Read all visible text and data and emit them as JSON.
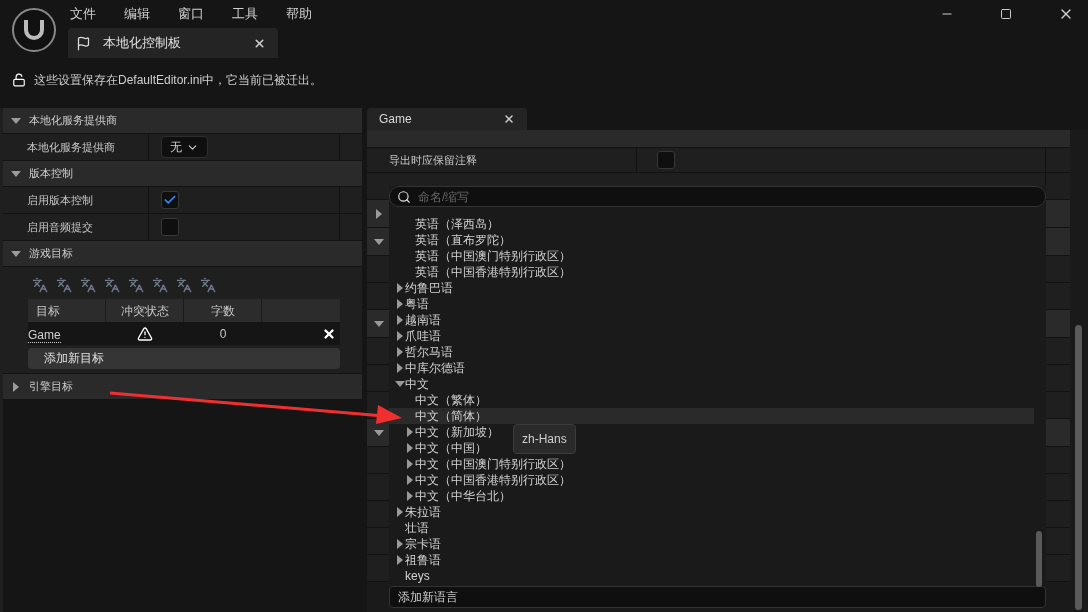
{
  "window": {
    "menu": [
      "文件",
      "编辑",
      "窗口",
      "工具",
      "帮助"
    ],
    "tab": {
      "label": "本地化控制板"
    }
  },
  "notice": "这些设置保存在DefaultEditor.ini中，它当前已被迁出。",
  "left_panel": {
    "sections": [
      {
        "kind": "properties",
        "title": "本地化服务提供商",
        "expanded": true,
        "rows": [
          {
            "kind": "dropdown",
            "label": "本地化服务提供商",
            "value": "无"
          }
        ]
      },
      {
        "kind": "properties",
        "title": "版本控制",
        "expanded": true,
        "rows": [
          {
            "kind": "checkbox",
            "label": "启用版本控制",
            "checked": true
          },
          {
            "kind": "checkbox",
            "label": "启用音频提交",
            "checked": false
          }
        ]
      },
      {
        "kind": "targets",
        "title": "游戏目标",
        "expanded": true,
        "columns": [
          "目标",
          "冲突状态",
          "字数"
        ],
        "rows": [
          {
            "name": "Game",
            "count": "0"
          }
        ],
        "add_button": "添加新目标"
      },
      {
        "kind": "properties",
        "title": "引擎目标",
        "expanded": false
      }
    ]
  },
  "right_panel": {
    "tab": {
      "label": "Game"
    },
    "rows": [
      {
        "kind": "header_cut"
      },
      {
        "kind": "checkbox",
        "label": "导出时应保留注释",
        "checked": false
      },
      {
        "kind": "row"
      },
      {
        "kind": "section",
        "expanded": false
      },
      {
        "kind": "section",
        "expanded": true
      },
      {
        "kind": "row"
      },
      {
        "kind": "row"
      },
      {
        "kind": "section",
        "expanded": true
      },
      {
        "kind": "row"
      },
      {
        "kind": "row"
      },
      {
        "kind": "row"
      },
      {
        "kind": "section",
        "expanded": true
      },
      {
        "kind": "row"
      },
      {
        "kind": "row"
      },
      {
        "kind": "row"
      },
      {
        "kind": "row"
      },
      {
        "kind": "row"
      }
    ]
  },
  "language_picker": {
    "placeholder": "命名/缩写",
    "items": [
      {
        "children": [
          {
            "kind": "leaf",
            "label": "英语（泽西岛）",
            "selected": false
          },
          {
            "kind": "leaf",
            "label": "英语（直布罗陀）",
            "selected": false
          },
          {
            "kind": "leaf",
            "label": "英语（中国澳门特别行政区）",
            "selected": false
          },
          {
            "kind": "leaf",
            "label": "英语（中国香港特别行政区）",
            "selected": false
          }
        ]
      },
      {
        "kind": "branch",
        "label": "约鲁巴语",
        "expanded": false,
        "selected": false
      },
      {
        "kind": "branch",
        "label": "粤语",
        "expanded": false,
        "selected": false
      },
      {
        "kind": "branch",
        "label": "越南语",
        "expanded": false,
        "selected": false
      },
      {
        "kind": "branch",
        "label": "爪哇语",
        "expanded": false,
        "selected": false
      },
      {
        "kind": "branch",
        "label": "哲尔马语",
        "expanded": false,
        "selected": false
      },
      {
        "kind": "branch",
        "label": "中库尔德语",
        "expanded": false,
        "selected": false
      },
      {
        "kind": "branch",
        "label": "中文",
        "expanded": true,
        "selected": false,
        "children": [
          {
            "kind": "leaf",
            "label": "中文（繁体）",
            "selected": false
          },
          {
            "kind": "leaf",
            "label": "中文（简体）",
            "selected": true
          },
          {
            "kind": "branch",
            "label": "中文（新加坡）",
            "expanded": false,
            "selected": false
          },
          {
            "kind": "branch",
            "label": "中文（中国）",
            "expanded": false,
            "selected": false
          },
          {
            "kind": "branch",
            "label": "中文（中国澳门特别行政区）",
            "expanded": false,
            "selected": false
          },
          {
            "kind": "branch",
            "label": "中文（中国香港特别行政区）",
            "expanded": false,
            "selected": false
          },
          {
            "kind": "branch",
            "label": "中文（中华台北）",
            "expanded": false,
            "selected": false
          }
        ]
      },
      {
        "kind": "branch",
        "label": "朱拉语",
        "expanded": false,
        "selected": false
      },
      {
        "kind": "leaf",
        "label": "壮语",
        "selected": false
      },
      {
        "kind": "branch",
        "label": "宗卡语",
        "expanded": false,
        "selected": false
      },
      {
        "kind": "branch",
        "label": "祖鲁语",
        "expanded": false,
        "selected": false
      },
      {
        "kind": "leaf",
        "label": "keys",
        "selected": false
      }
    ],
    "tooltip": "zh-Hans",
    "add_field": "添加新语言"
  }
}
